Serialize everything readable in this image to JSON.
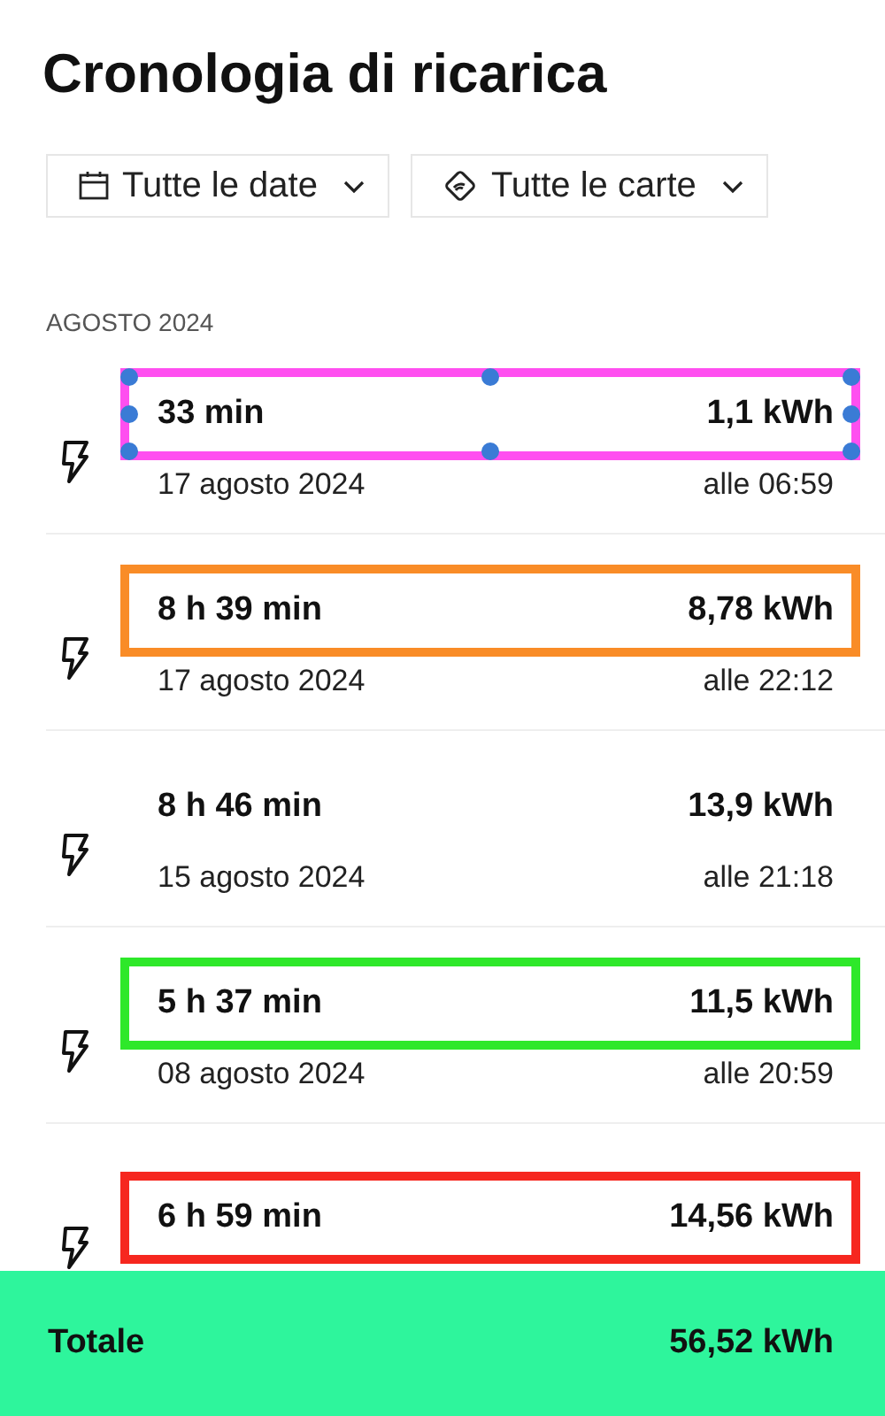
{
  "title": "Cronologia di ricarica",
  "filters": [
    {
      "kind": "date",
      "label": "Tutte le date"
    },
    {
      "kind": "card",
      "label": "Tutte le carte"
    }
  ],
  "section": "AGOSTO 2024",
  "sessions": [
    {
      "duration": "33 min",
      "energy": "1,1 kWh",
      "date": "17 agosto 2024",
      "time": "alle 06:59",
      "color": "#ff4ff0",
      "selected": true
    },
    {
      "duration": "8 h 39 min",
      "energy": "8,78 kWh",
      "date": "17 agosto 2024",
      "time": "alle 22:12",
      "color": "#f98c27",
      "selected": false
    },
    {
      "duration": "8 h 46 min",
      "energy": "13,9 kWh",
      "date": "15 agosto 2024",
      "time": "alle 21:18"
    },
    {
      "duration": "5 h 37 min",
      "energy": "11,5 kWh",
      "date": "08 agosto 2024",
      "time": "alle 20:59",
      "color": "#2ee82a",
      "selected": false
    },
    {
      "duration": "6 h 59 min",
      "energy": "14,56 kWh",
      "color": "#f6271f",
      "selected": false
    }
  ],
  "total": {
    "label": "Totale",
    "value": "56,52 kWh"
  }
}
